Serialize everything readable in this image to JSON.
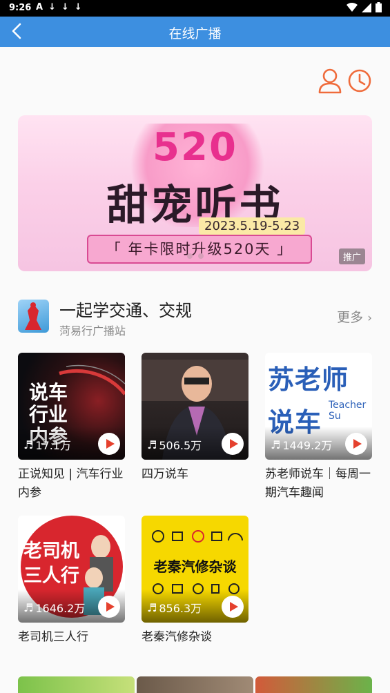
{
  "status_bar": {
    "time": "9:26",
    "notif_icons": [
      "A",
      "↓",
      "↓",
      "↓"
    ]
  },
  "app_bar": {
    "title": "在线广播"
  },
  "banner": {
    "big_number": "520",
    "slogan": "甜宠听书",
    "date_range": "2023.5.19-5.23",
    "offer": "「 年卡限时升级520天 」",
    "ad_label": "推广"
  },
  "section": {
    "title": "一起学交通、交规",
    "subtitle": "菏易行广播站",
    "more": "更多"
  },
  "cards": [
    {
      "cover_text": "说车行业内参",
      "plays": "17.1万",
      "name": "正说知见 | 汽车行业内参"
    },
    {
      "cover_text": "",
      "plays": "506.5万",
      "name": "四万说车"
    },
    {
      "cover_text": "苏老师说车",
      "cover_sub": "Teacher Su",
      "plays": "1449.2万",
      "name": "苏老师说车｜每周一期汽车趣闻"
    },
    {
      "cover_text": "老司机三人行",
      "plays": "1646.2万",
      "name": "老司机三人行"
    },
    {
      "cover_text": "老秦汽修杂谈",
      "plays": "856.3万",
      "name": "老秦汽修杂谈"
    }
  ],
  "colors": {
    "accent": "#3d8fe0",
    "orange": "#ef6b3b",
    "play_red": "#e5412e"
  }
}
